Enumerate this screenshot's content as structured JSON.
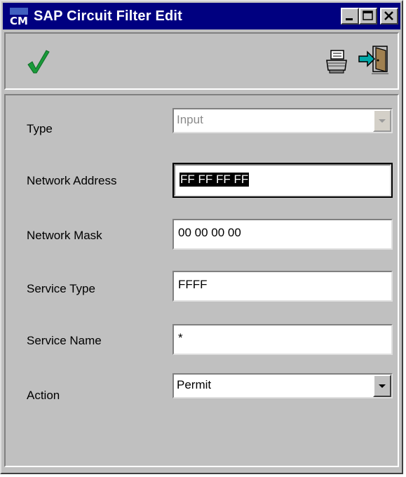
{
  "window": {
    "title": "SAP Circuit Filter Edit",
    "app_icon": "cm-app-icon",
    "controls": [
      "minimize-icon",
      "maximize-icon",
      "close-icon"
    ]
  },
  "toolbar": {
    "tools": [
      "checkmark-icon",
      "printer-icon",
      "exit-door-icon"
    ]
  },
  "form": {
    "type": {
      "label": "Type",
      "value": "Input",
      "disabled": true
    },
    "network_address": {
      "label": "Network Address",
      "value": "FF FF FF FF"
    },
    "network_mask": {
      "label": "Network Mask",
      "value": "00 00 00 00"
    },
    "service_type": {
      "label": "Service Type",
      "value": "FFFF"
    },
    "service_name": {
      "label": "Service Name",
      "value": "*"
    },
    "action": {
      "label": "Action",
      "value": "Permit"
    }
  },
  "colors": {
    "titlebar": "#000080",
    "face": "#c0c0c0",
    "check_green": "#1a9a3a",
    "exit_cyan": "#00a8a8"
  }
}
